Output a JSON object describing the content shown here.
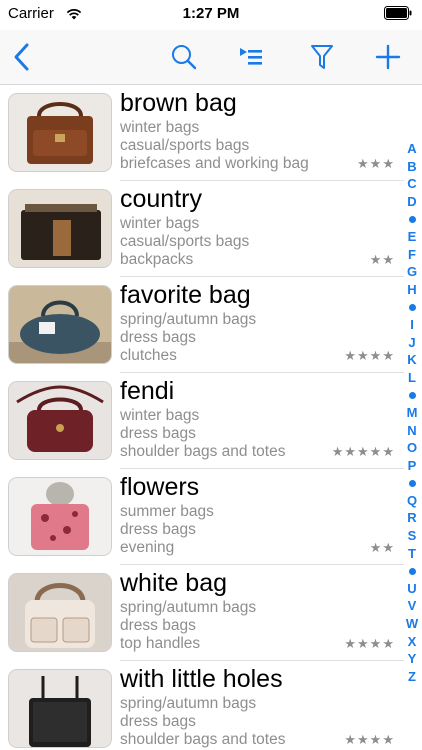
{
  "status": {
    "carrier": "Carrier",
    "time": "1:27 PM"
  },
  "nav": {
    "back_icon": "chevron-left-icon",
    "search_icon": "search-icon",
    "sort_icon": "sort-list-icon",
    "filter_icon": "filter-icon",
    "add_icon": "plus-icon"
  },
  "items": [
    {
      "title": "brown bag",
      "season": "winter bags",
      "category": "casual/sports bags",
      "type": "briefcases and working bag",
      "stars": "★★★",
      "rating": 3
    },
    {
      "title": "country",
      "season": "winter bags",
      "category": "casual/sports bags",
      "type": "backpacks",
      "stars": "★★",
      "rating": 2
    },
    {
      "title": "favorite bag",
      "season": "spring/autumn bags",
      "category": "dress bags",
      "type": "clutches",
      "stars": "★★★★",
      "rating": 4
    },
    {
      "title": "fendi",
      "season": "winter bags",
      "category": "dress bags",
      "type": "shoulder bags and totes",
      "stars": "★★★★★",
      "rating": 5
    },
    {
      "title": "flowers",
      "season": "summer bags",
      "category": "dress bags",
      "type": "evening",
      "stars": "★★",
      "rating": 2
    },
    {
      "title": "white bag",
      "season": "spring/autumn bags",
      "category": "dress bags",
      "type": "top handles",
      "stars": "★★★★",
      "rating": 4
    },
    {
      "title": "with little holes",
      "season": "spring/autumn bags",
      "category": "dress bags",
      "type": "shoulder bags and totes",
      "stars": "★★★★",
      "rating": 4
    }
  ],
  "index": [
    "A",
    "B",
    "C",
    "D",
    "•",
    "E",
    "F",
    "G",
    "H",
    "•",
    "I",
    "J",
    "K",
    "L",
    "•",
    "M",
    "N",
    "O",
    "P",
    "•",
    "Q",
    "R",
    "S",
    "T",
    "•",
    "U",
    "V",
    "W",
    "X",
    "Y",
    "Z"
  ],
  "colors": {
    "accent": "#1a7ae6",
    "secondary_text": "#8e8e8e"
  }
}
